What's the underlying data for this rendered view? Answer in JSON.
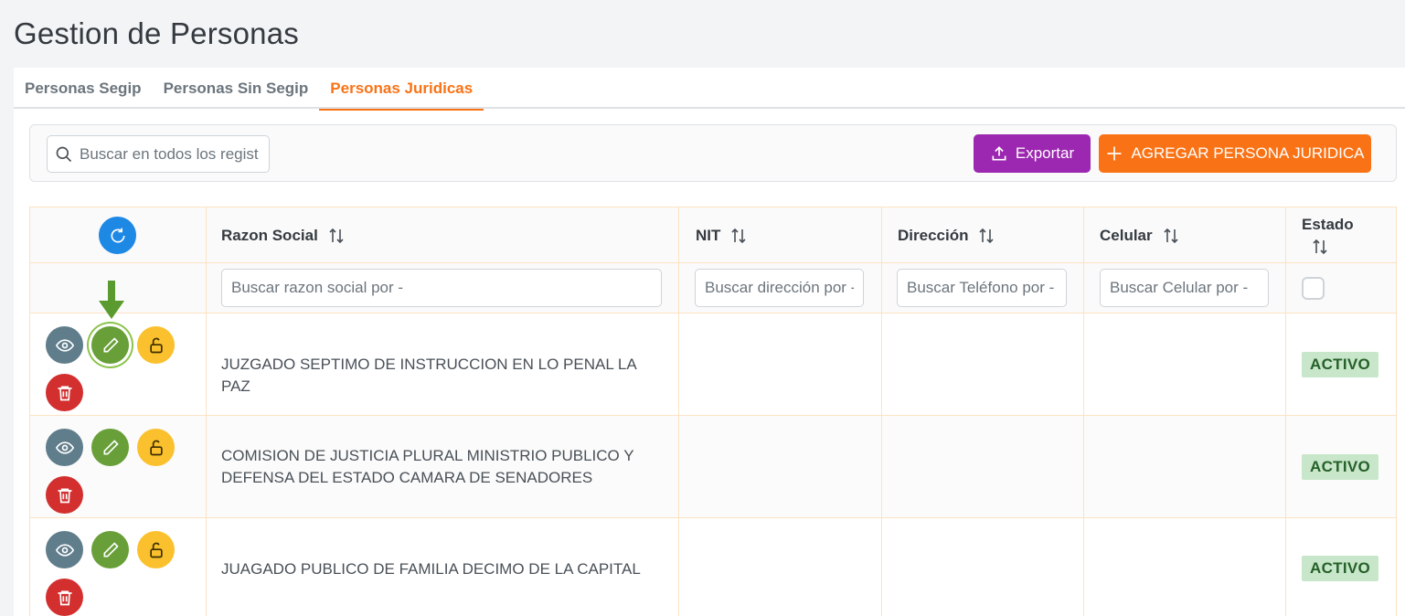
{
  "page": {
    "title": "Gestion de Personas"
  },
  "tabs": [
    {
      "label": "Personas Segip",
      "active": false
    },
    {
      "label": "Personas Sin Segip",
      "active": false
    },
    {
      "label": "Personas Juridicas",
      "active": true
    }
  ],
  "toolbar": {
    "search_placeholder": "Buscar en todos los regist",
    "export_label": "Exportar",
    "add_label": "AGREGAR PERSONA JURIDICA"
  },
  "table": {
    "columns": [
      {
        "label": "Razon Social"
      },
      {
        "label": "NIT"
      },
      {
        "label": "Dirección"
      },
      {
        "label": "Celular"
      },
      {
        "label": "Estado"
      }
    ],
    "filters": {
      "razon_social": "Buscar razon social por -",
      "nit": "Buscar dirección por -",
      "direccion": "Buscar Teléfono por -",
      "celular": "Buscar Celular por -"
    },
    "rows": [
      {
        "razon_social": "JUZGADO SEPTIMO DE INSTRUCCION EN LO PENAL LA PAZ",
        "nit": "",
        "direccion": "",
        "celular": "",
        "estado": "ACTIVO"
      },
      {
        "razon_social": "COMISION DE JUSTICIA PLURAL MINISTRIO PUBLICO Y DEFENSA DEL ESTADO CAMARA DE SENADORES",
        "nit": "",
        "direccion": "",
        "celular": "",
        "estado": "ACTIVO"
      },
      {
        "razon_social": "JUAGADO PUBLICO DE FAMILIA DECIMO DE LA CAPITAL",
        "nit": "",
        "direccion": "",
        "celular": "",
        "estado": "ACTIVO"
      }
    ]
  },
  "colors": {
    "accent": "#f97316",
    "export": "#9c27b0",
    "refresh": "#1e88e5",
    "view": "#607d8b",
    "edit": "#689f38",
    "lock": "#fbc02d",
    "delete": "#d32f2f",
    "status_bg": "#c8e6c9",
    "status_text": "#256029",
    "annotation_arrow": "#5b9a2e"
  },
  "icons": [
    "search-icon",
    "upload-icon",
    "plus-icon",
    "refresh-icon",
    "sort-icon",
    "eye-icon",
    "pencil-icon",
    "unlock-icon",
    "trash-icon",
    "arrow-down-icon"
  ]
}
